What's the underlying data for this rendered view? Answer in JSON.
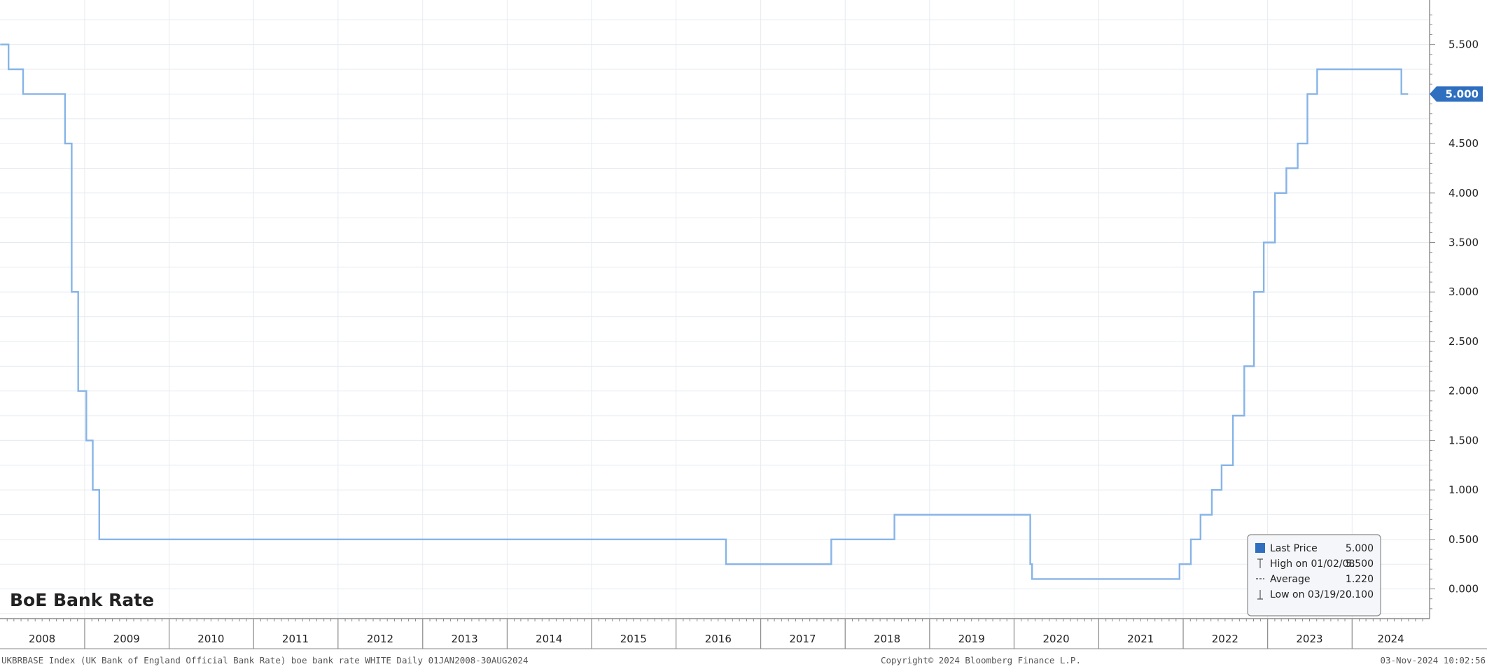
{
  "colors": {
    "line": "#87b4e8",
    "last_price_badge": "#2f6fbf",
    "grid": "#e6ebf0",
    "axis": "#8a8a8a",
    "text": "#222222",
    "footer_text": "#555555",
    "legend_bg": "#f4f6f9",
    "legend_border": "#8a8a8a",
    "legend_square": "#2f6fbf"
  },
  "chart_data": {
    "type": "line",
    "title": "BoE Bank Rate",
    "x_tick_labels": [
      "2008",
      "2009",
      "2010",
      "2011",
      "2012",
      "2013",
      "2014",
      "2015",
      "2016",
      "2017",
      "2018",
      "2019",
      "2020",
      "2021",
      "2022",
      "2023",
      "2024"
    ],
    "y_tick_labels": [
      "0.000",
      "0.500",
      "1.000",
      "1.500",
      "2.000",
      "2.500",
      "3.000",
      "3.500",
      "4.000",
      "4.500",
      "5.000",
      "5.500"
    ],
    "ylim": [
      -0.3,
      5.95
    ],
    "grid": true,
    "legend_position": "bottom-right",
    "last_price_label": "5.000",
    "series": [
      {
        "step": true,
        "points": [
          {
            "x": "2008-01-02",
            "y": 5.5
          },
          {
            "x": "2008-02-07",
            "y": 5.25
          },
          {
            "x": "2008-04-10",
            "y": 5.0
          },
          {
            "x": "2008-10-08",
            "y": 4.5
          },
          {
            "x": "2008-11-06",
            "y": 3.0
          },
          {
            "x": "2008-12-04",
            "y": 2.0
          },
          {
            "x": "2009-01-08",
            "y": 1.5
          },
          {
            "x": "2009-02-05",
            "y": 1.0
          },
          {
            "x": "2009-03-05",
            "y": 0.5
          },
          {
            "x": "2016-08-04",
            "y": 0.25
          },
          {
            "x": "2017-11-02",
            "y": 0.5
          },
          {
            "x": "2018-08-02",
            "y": 0.75
          },
          {
            "x": "2020-03-11",
            "y": 0.25
          },
          {
            "x": "2020-03-19",
            "y": 0.1
          },
          {
            "x": "2021-12-16",
            "y": 0.25
          },
          {
            "x": "2022-02-03",
            "y": 0.5
          },
          {
            "x": "2022-03-17",
            "y": 0.75
          },
          {
            "x": "2022-05-05",
            "y": 1.0
          },
          {
            "x": "2022-06-16",
            "y": 1.25
          },
          {
            "x": "2022-08-04",
            "y": 1.75
          },
          {
            "x": "2022-09-22",
            "y": 2.25
          },
          {
            "x": "2022-11-03",
            "y": 3.0
          },
          {
            "x": "2022-12-15",
            "y": 3.5
          },
          {
            "x": "2023-02-02",
            "y": 4.0
          },
          {
            "x": "2023-03-23",
            "y": 4.25
          },
          {
            "x": "2023-05-11",
            "y": 4.5
          },
          {
            "x": "2023-06-22",
            "y": 5.0
          },
          {
            "x": "2023-08-03",
            "y": 5.25
          },
          {
            "x": "2024-08-01",
            "y": 5.0
          },
          {
            "x": "2024-08-30",
            "y": 5.0
          }
        ]
      }
    ],
    "legend": [
      {
        "label": "Last Price",
        "value": "5.000",
        "marker": "square"
      },
      {
        "label": "High on 01/02/08",
        "value": "5.500",
        "marker": "high"
      },
      {
        "label": "Average",
        "value": "1.220",
        "marker": "average"
      },
      {
        "label": "Low on 03/19/20",
        "value": "0.100",
        "marker": "low"
      }
    ]
  },
  "footer": {
    "left": "UKBRBASE Index (UK Bank of England Official Bank Rate) boe bank rate WHITE  Daily 01JAN2008-30AUG2024",
    "center": "Copyright© 2024 Bloomberg Finance L.P.",
    "right": "03-Nov-2024 10:02:56"
  }
}
